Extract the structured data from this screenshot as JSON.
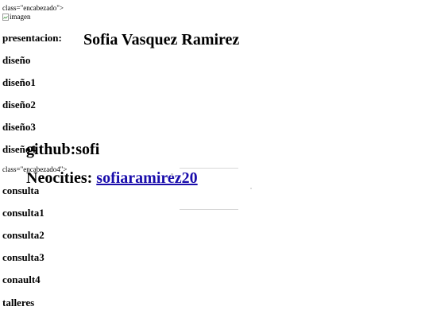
{
  "header": {
    "stray_text_1": "class=\"encabezado\">",
    "image_alt": "imagen",
    "stray_text_2": "class=\"encabezado4\">"
  },
  "title": "Sofia Vasquez Ramirez",
  "nav": {
    "items": [
      "presentacion:",
      "diseño",
      "diseño1",
      "diseño2",
      "diseño3",
      "diseño4",
      "consulta",
      "consulta1",
      "consulta2",
      "consulta3",
      "conault4",
      "talleres"
    ]
  },
  "github": {
    "text": "github:sofi"
  },
  "neocities": {
    "label": "Neocities:",
    "link_text": "sofiaramirez20"
  },
  "icons": [
    "broken-image-icon"
  ]
}
